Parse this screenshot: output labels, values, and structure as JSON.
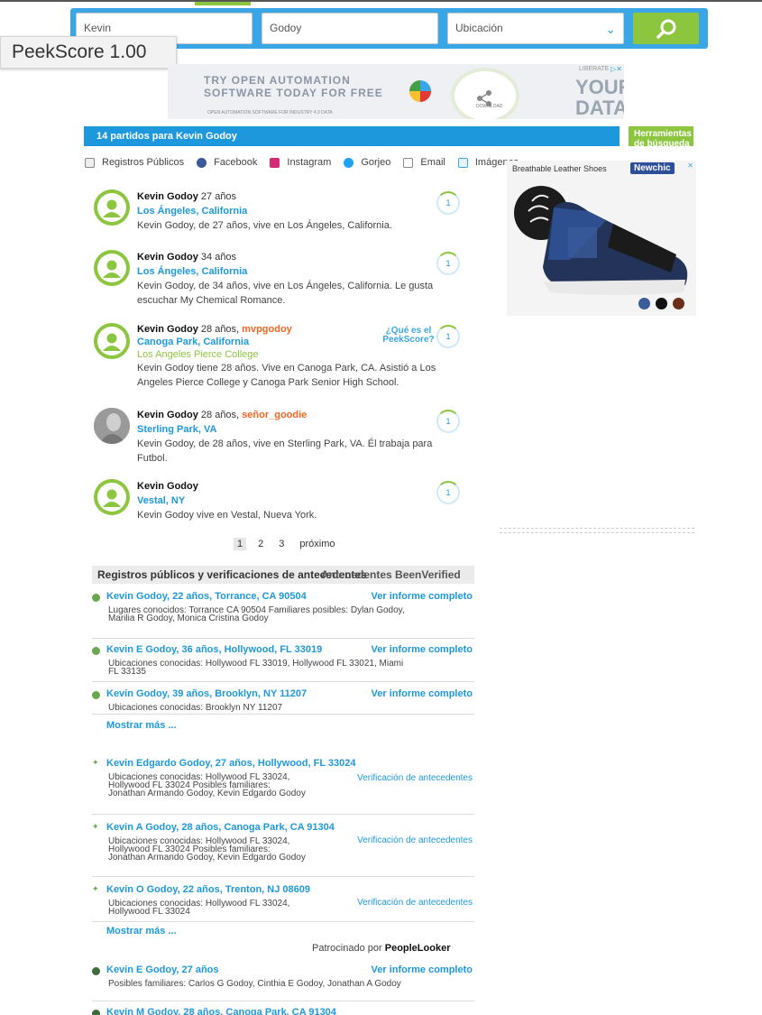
{
  "search": {
    "first_name": "Kevin",
    "last_name": "Godoy",
    "location": "Ubicación"
  },
  "peekscore_badge": "PeekScore 1.00",
  "ad_banner": {
    "line1": "TRY OPEN AUTOMATION",
    "line2": "SOFTWARE TODAY FOR FREE",
    "line3": "OPEN AUTOMATION SOFTWARE FOR INDUSTRY 4.0 DATA",
    "share_label": "DOWNLOAD",
    "right_small": "LIBERATE",
    "right_big1": "YOUR",
    "right_big2": "DATA"
  },
  "results_header": "14 partidos para Kevin Godoy",
  "tools_header": "Herramientas de búsqueda",
  "filters": [
    "Registros Públicos",
    "Facebook",
    "Instagram",
    "Gorjeo",
    "Email",
    "Imágenes"
  ],
  "right_ad": {
    "title": "Breathable Leather Shoes",
    "brand": "Newchic"
  },
  "colors": {
    "blue": "#1e98dc",
    "green": "#8cc63f",
    "orange": "#f26522"
  },
  "people": [
    {
      "name": "Kevin Godoy",
      "age": "27 años",
      "location": "Los Ángeles, California",
      "desc": "Kevin Godoy, de 27 años, vive en Los Ángeles, California.",
      "score": "1"
    },
    {
      "name": "Kevin Godoy",
      "age": "34 años",
      "location": "Los Ángeles, California",
      "desc": "Kevin Godoy, de 34 años, vive en Los Ángeles, California. Le gusta escuchar My Chemical Romance.",
      "score": "1"
    },
    {
      "name": "Kevin Godoy",
      "age": "28 años,",
      "username": "mvpgodoy",
      "location": "Canoga Park, California",
      "school": "Los Angeles Pierce College",
      "desc": "Kevin Godoy tiene 28 años. Vive en Canoga Park, CA. Asistió a Los Angeles Pierce College y Canoga Park Senior High School.",
      "score": "1"
    },
    {
      "name": "Kevin Godoy",
      "age": "28 años,",
      "username": "señor_goodie",
      "location": "Sterling Park, VA",
      "desc": "Kevin Godoy, de 28 años, vive en Sterling Park, VA. Él trabaja para Futbol.",
      "score": "1"
    },
    {
      "name": "Kevin Godoy",
      "location": "Vestal, NY",
      "desc": "Kevin Godoy vive en Vestal, Nueva York.",
      "score": "1"
    }
  ],
  "peekscore_what": "¿Qué es el PeekScore?",
  "pagination": [
    "1",
    "2",
    "3",
    "próximo"
  ],
  "records": {
    "header": "Registros públicos y verificaciones de antecedentes",
    "header_overlay": "Antecedentes BeenVerified",
    "group1": [
      {
        "title": "Kevin Godoy, 22 años, Torrance, CA 90504",
        "action": "Ver informe completo",
        "body": "Lugares conocidos: Torrance CA 90504 Familiares posibles: Dylan Godoy, Marilia R Godoy, Monica Cristina Godoy"
      },
      {
        "title": "Kevin E Godoy, 36 años, Hollywood, FL 33019",
        "action": "Ver informe completo",
        "body": "Ubicaciones conocidas: Hollywood FL 33019, Hollywood FL 33021, Miami FL 33135"
      },
      {
        "title": "Kevin Godoy, 39 años, Brooklyn, NY 11207",
        "action": "Ver informe completo",
        "body": "Ubicaciones conocidas: Brooklyn NY 11207"
      }
    ],
    "more1": "Mostrar más ...",
    "group2": [
      {
        "title": "Kevin Edgardo Godoy, 27 años, Hollywood, FL 33024",
        "action": "Verificación de antecedentes",
        "body": "Ubicaciones conocidas: Hollywood FL 33024, Hollywood FL 33024 Posibles familiares: Jonathan Armando Godoy, Kevin Edgardo Godoy"
      },
      {
        "title": "Kevin A Godoy, 28 años, Canoga Park, CA 91304",
        "action": "Verificación de antecedentes",
        "body": "Ubicaciones conocidas: Hollywood FL 33024, Hollywood FL 33024 Posibles familiares: Jonathan Armando Godoy, Kevin Edgardo Godoy"
      },
      {
        "title": "Kevin O Godoy, 22 años, Trenton, NJ 08609",
        "action": "Verificación de antecedentes",
        "body": "Ubicaciones conocidas: Hollywood FL 33024, Hollywood FL 33024"
      }
    ],
    "more2": "Mostrar más ...",
    "sponsored_prefix": "Patrocinado por",
    "sponsored_brand": "PeopleLooker",
    "group3": [
      {
        "title": "Kevin E Godoy, 27 años",
        "action": "Ver informe completo",
        "body": "Posibles familiares: Carlos G Godoy, Cinthia E Godoy, Jonathan A Godoy"
      },
      {
        "title": "Kevin M Godoy, 28 años, Canoga Park, CA 91304"
      }
    ]
  }
}
